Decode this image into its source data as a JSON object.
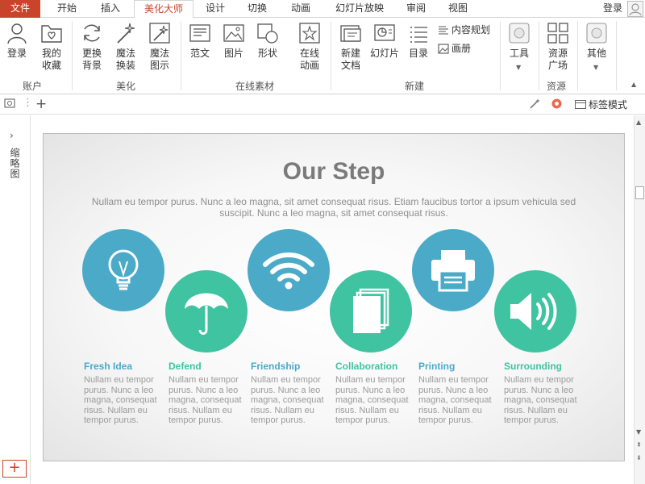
{
  "tabs": [
    {
      "label": "文件",
      "kind": "file"
    },
    {
      "label": "开始",
      "kind": "normal"
    },
    {
      "label": "插入",
      "kind": "normal"
    },
    {
      "label": "美化大师",
      "kind": "active"
    },
    {
      "label": "设计",
      "kind": "normal"
    },
    {
      "label": "切换",
      "kind": "normal"
    },
    {
      "label": "动画",
      "kind": "normal"
    },
    {
      "label": "幻灯片放映",
      "kind": "normal"
    },
    {
      "label": "审阅",
      "kind": "normal"
    },
    {
      "label": "视图",
      "kind": "normal"
    }
  ],
  "login_label": "登录",
  "ribbon": {
    "account": {
      "login": "登录",
      "favorites": "我的\n收藏",
      "group": "账户"
    },
    "beautify": {
      "change_bg": "更换\n背景",
      "magic_swap": "魔法\n换装",
      "magic_diagram": "魔法\n图示",
      "group": "美化"
    },
    "online": {
      "template": "范文",
      "picture": "图片",
      "shape": "形状",
      "animation": "在线\n动画",
      "group": "在线素材"
    },
    "new": {
      "new_doc": "新建\n文档",
      "slide": "幻灯片",
      "toc": "目录",
      "content_plan": "内容规划",
      "album": "画册",
      "group": "新建"
    },
    "tools": {
      "label": "工具"
    },
    "resources": {
      "square": "资源\n广场",
      "group": "资源"
    },
    "other": {
      "label": "其他"
    }
  },
  "quickbar": {
    "mark_mode": "标签模式"
  },
  "left_panel": {
    "thumbnails": "缩略图",
    "add": "+"
  },
  "slide": {
    "title": "Our Step",
    "subtitle": "Nullam eu tempor purus. Nunc a leo magna, sit amet consequat risus. Etiam faucibus tortor a ipsum vehicula sed suscipit. Nunc a leo magna, sit amet consequat risus.",
    "colors": {
      "blue": "#4aaac8",
      "green": "#3fc3a1"
    },
    "steps": [
      {
        "title": "Fresh Idea",
        "icon": "lightbulb-icon",
        "color": "blue",
        "text": "Nullam eu tempor purus. Nunc a leo magna, consequat risus. Nullam eu tempor purus."
      },
      {
        "title": "Defend",
        "icon": "umbrella-icon",
        "color": "green",
        "text": "Nullam eu tempor purus. Nunc a leo magna, consequat risus. Nullam eu tempor purus."
      },
      {
        "title": "Friendship",
        "icon": "wifi-icon",
        "color": "blue",
        "text": "Nullam eu tempor purus. Nunc a leo magna, consequat risus. Nullam eu tempor purus."
      },
      {
        "title": "Collaboration",
        "icon": "documents-icon",
        "color": "green",
        "text": "Nullam eu tempor purus. Nunc a leo magna, consequat risus. Nullam eu tempor purus."
      },
      {
        "title": "Printing",
        "icon": "printer-icon",
        "color": "blue",
        "text": "Nullam eu tempor purus. Nunc a leo magna, consequat risus. Nullam eu tempor purus."
      },
      {
        "title": "Surrounding",
        "icon": "speaker-icon",
        "color": "green",
        "text": "Nullam eu tempor purus. Nunc a leo magna, consequat risus. Nullam eu tempor purus."
      }
    ]
  }
}
